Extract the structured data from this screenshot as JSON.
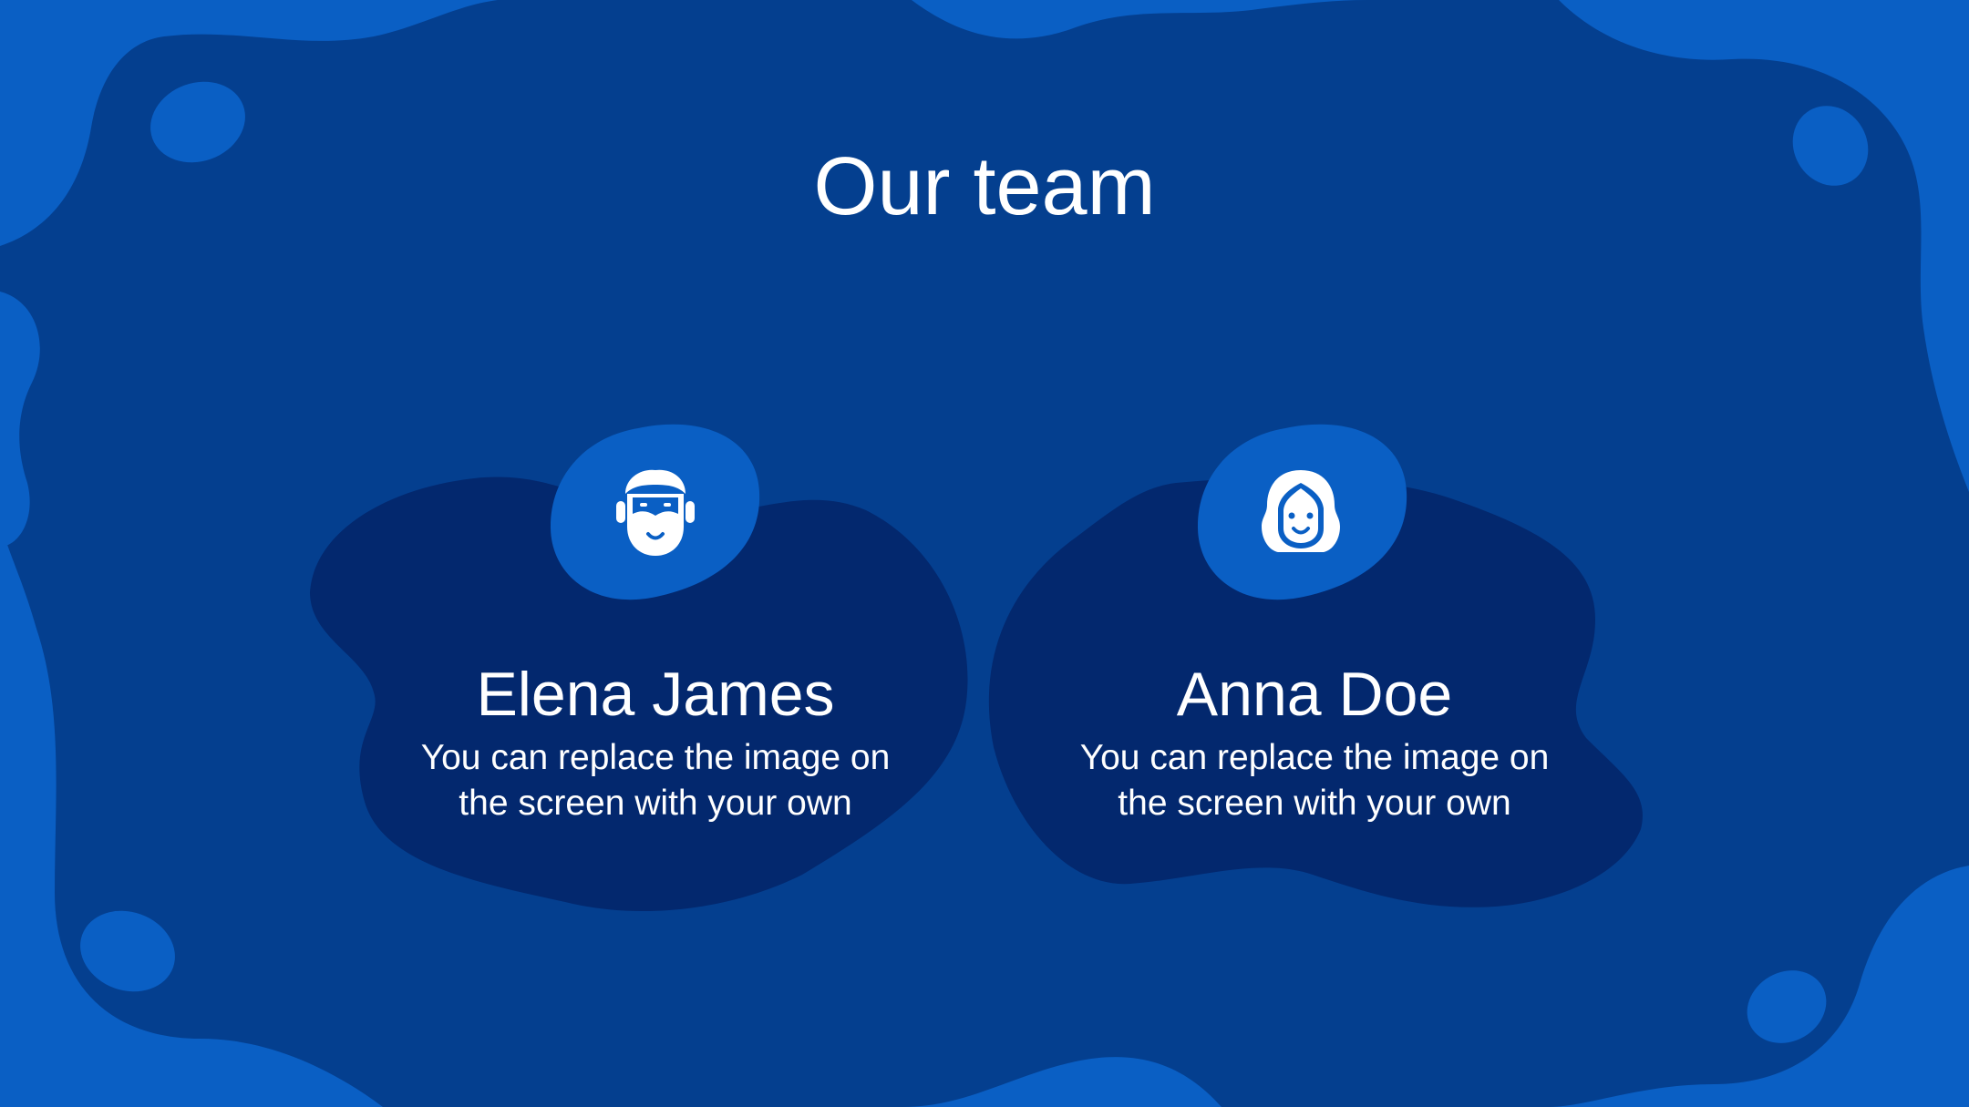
{
  "slide": {
    "title": "Our team"
  },
  "members": [
    {
      "name": "Elena James",
      "desc_line1": "You can replace the image on",
      "desc_line2": "the screen with your own",
      "avatar_icon": "man-bearded-avatar-icon"
    },
    {
      "name": "Anna Doe",
      "desc_line1": "You can replace the image on",
      "desc_line2": "the screen with your own",
      "avatar_icon": "woman-avatar-icon"
    }
  ],
  "colors": {
    "outer_frame": "#0a5fc4",
    "background": "#043f8f",
    "card_blob": "#03286e",
    "avatar_blob": "#0a5fc4",
    "text": "#ffffff"
  }
}
